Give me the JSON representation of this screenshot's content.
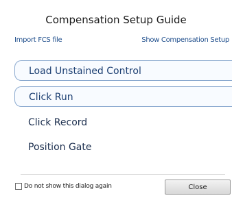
{
  "dialog": {
    "title": "Compensation Setup Guide",
    "links": {
      "import": "Import FCS file",
      "show_setup": "Show Compensation Setup"
    },
    "steps": [
      {
        "label": "Load Unstained Control",
        "highlighted": true
      },
      {
        "label": "Click Run",
        "highlighted": true
      },
      {
        "label": "Click Record",
        "highlighted": false
      },
      {
        "label": "Position Gate",
        "highlighted": false
      }
    ],
    "footer": {
      "checkbox_label": "Do not show this dialog again",
      "checkbox_checked": false,
      "close_label": "Close"
    }
  },
  "colors": {
    "link": "#1f4e8c",
    "step_text": "#1c3f72",
    "step_border": "#8aa9cf"
  }
}
